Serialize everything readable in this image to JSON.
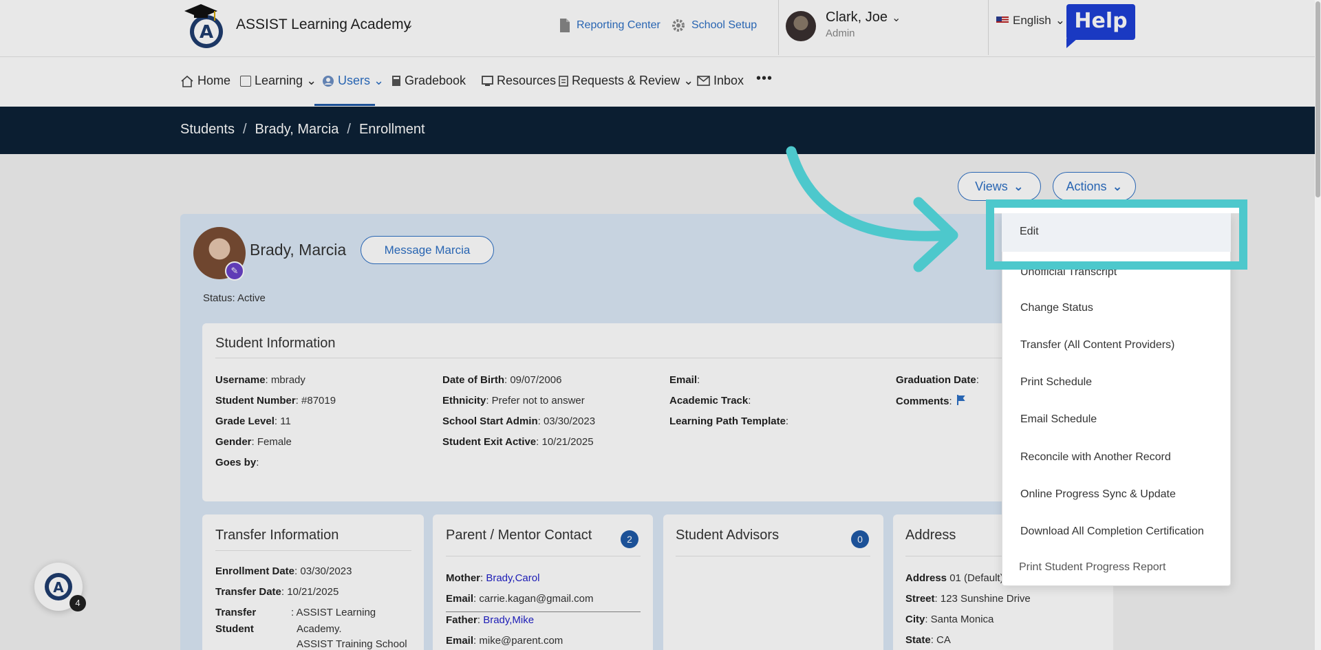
{
  "header": {
    "school_name": "ASSIST Learning Academy",
    "reporting_center": "Reporting Center",
    "school_setup": "School Setup",
    "user_name": "Clark, Joe",
    "user_role": "Admin",
    "language": "English",
    "help_label": "Help"
  },
  "nav": {
    "items": [
      {
        "label": "Home"
      },
      {
        "label": "Learning"
      },
      {
        "label": "Users"
      },
      {
        "label": "Gradebook"
      },
      {
        "label": "Resources"
      },
      {
        "label": "Requests & Review"
      },
      {
        "label": "Inbox"
      }
    ],
    "more": "•••"
  },
  "breadcrumb": {
    "items": [
      "Students",
      "Brady, Marcia",
      "Enrollment"
    ],
    "separator": "/"
  },
  "toolbar": {
    "views_label": "Views",
    "actions_label": "Actions"
  },
  "student": {
    "name": "Brady, Marcia",
    "message_button": "Message Marcia",
    "status": "Status: Active"
  },
  "student_info": {
    "title": "Student Information",
    "col1": [
      {
        "label": "Username",
        "value": ": mbrady"
      },
      {
        "label": "Student Number",
        "value": ": #87019"
      },
      {
        "label": "Grade Level",
        "value": ": 11"
      },
      {
        "label": "Gender",
        "value": ": Female"
      },
      {
        "label": "Goes by",
        "value": ":"
      }
    ],
    "col2": [
      {
        "label": "Date of Birth",
        "value": ": 09/07/2006"
      },
      {
        "label": "Ethnicity",
        "value": ": Prefer not to answer"
      },
      {
        "label": "School Start Admin",
        "value": ": 03/30/2023"
      },
      {
        "label": "Student Exit Active",
        "value": ": 10/21/2025"
      }
    ],
    "col3": [
      {
        "label": "Email",
        "value": ":"
      },
      {
        "label": "Academic Track",
        "value": ":"
      },
      {
        "label": "Learning Path Template",
        "value": ":"
      }
    ],
    "col4": [
      {
        "label": "Graduation Date",
        "value": ":"
      },
      {
        "label": "Comments",
        "value": ":"
      }
    ]
  },
  "transfer": {
    "title": "Transfer Information",
    "enrollment_label": "Enrollment Date",
    "enrollment_value": ": 03/30/2023",
    "transfer_label": "Transfer Date",
    "transfer_value": ": 10/21/2025",
    "student_label_1": "Transfer",
    "student_label_2": "Student",
    "student_value_1": ": ASSIST Learning",
    "student_value_2": "Academy.",
    "student_value_3": "ASSIST Training School"
  },
  "parent": {
    "title": "Parent / Mentor Contact",
    "count": "2",
    "mother_label": "Mother",
    "mother_name": "Brady,Carol",
    "mother_email_label": "Email",
    "mother_email": ": carrie.kagan@gmail.com",
    "father_label": "Father",
    "father_name": "Brady,Mike",
    "father_email_label": "Email",
    "father_email": ": mike@parent.com"
  },
  "advisors": {
    "title": "Student Advisors",
    "count": "0"
  },
  "address": {
    "title": "Address",
    "address_label": "Address",
    "address_value": " 01 (Default)",
    "street_label": "Street",
    "street_value": ": 123 Sunshine Drive",
    "city_label": "City",
    "city_value": ": Santa Monica",
    "state_label": "State",
    "state_value": ": CA"
  },
  "actions_menu": {
    "items": [
      "Edit",
      "Unofficial Transcript",
      "Change Status",
      "Transfer (All Content Providers)",
      "Print Schedule",
      "Email Schedule",
      "Reconcile with Another Record",
      "Online Progress Sync & Update",
      "Download All Completion Certification",
      "Print Student Progress Report"
    ]
  },
  "chat": {
    "badge": "4"
  },
  "colors": {
    "accent": "#2d6fc4",
    "band": "#0d2236",
    "highlight": "#4dc8cc",
    "help": "#1d3fd6"
  }
}
